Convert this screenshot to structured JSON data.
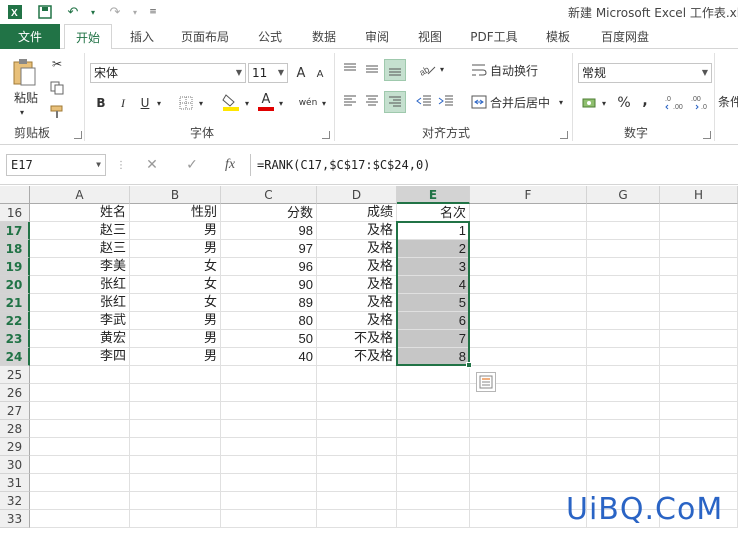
{
  "window": {
    "title": "新建 Microsoft Excel 工作表.xl"
  },
  "tabs": {
    "file": "文件",
    "items": [
      "开始",
      "插入",
      "页面布局",
      "公式",
      "数据",
      "审阅",
      "视图",
      "PDF工具",
      "模板",
      "百度网盘"
    ]
  },
  "ribbon": {
    "clipboard": {
      "label": "剪贴板",
      "paste": "粘贴"
    },
    "font": {
      "label": "字体",
      "name": "宋体",
      "size": "11",
      "bold": "B",
      "italic": "I",
      "underline": "U",
      "grow": "A",
      "shrink": "A",
      "phonetic": "wén",
      "font_color_letter": "A"
    },
    "alignment": {
      "label": "对齐方式",
      "wrap": "自动换行",
      "merge": "合并后居中"
    },
    "number": {
      "label": "数字",
      "format": "常规",
      "percent": "%",
      "comma": ","
    },
    "conditional": {
      "label": "条件"
    },
    "colors": {
      "accent": "#217346",
      "fill_yellow": "#ffe600",
      "font_red": "#e00000"
    }
  },
  "formula_bar": {
    "name_box": "E17",
    "cancel": "✕",
    "enter": "✓",
    "fx": "fx",
    "formula": "=RANK(C17,$C$17:$C$24,0)"
  },
  "grid": {
    "columns": [
      "A",
      "B",
      "C",
      "D",
      "E",
      "F",
      "G",
      "H"
    ],
    "rows": [
      {
        "num": "16",
        "cells": [
          "姓名",
          "性别",
          "分数",
          "成绩",
          "名次"
        ]
      },
      {
        "num": "17",
        "cells": [
          "赵三",
          "男",
          "98",
          "及格",
          "1"
        ]
      },
      {
        "num": "18",
        "cells": [
          "赵三",
          "男",
          "97",
          "及格",
          "2"
        ]
      },
      {
        "num": "19",
        "cells": [
          "李美",
          "女",
          "96",
          "及格",
          "3"
        ]
      },
      {
        "num": "20",
        "cells": [
          "张红",
          "女",
          "90",
          "及格",
          "4"
        ]
      },
      {
        "num": "21",
        "cells": [
          "张红",
          "女",
          "89",
          "及格",
          "5"
        ]
      },
      {
        "num": "22",
        "cells": [
          "李武",
          "男",
          "80",
          "及格",
          "6"
        ]
      },
      {
        "num": "23",
        "cells": [
          "黄宏",
          "男",
          "50",
          "不及格",
          "7"
        ]
      },
      {
        "num": "24",
        "cells": [
          "李四",
          "男",
          "40",
          "不及格",
          "8"
        ]
      },
      {
        "num": "25",
        "cells": []
      },
      {
        "num": "26",
        "cells": []
      },
      {
        "num": "27",
        "cells": []
      },
      {
        "num": "28",
        "cells": []
      },
      {
        "num": "29",
        "cells": []
      },
      {
        "num": "30",
        "cells": []
      },
      {
        "num": "31",
        "cells": []
      },
      {
        "num": "32",
        "cells": []
      },
      {
        "num": "33",
        "cells": []
      }
    ]
  },
  "watermark": "UiBQ.CoM"
}
